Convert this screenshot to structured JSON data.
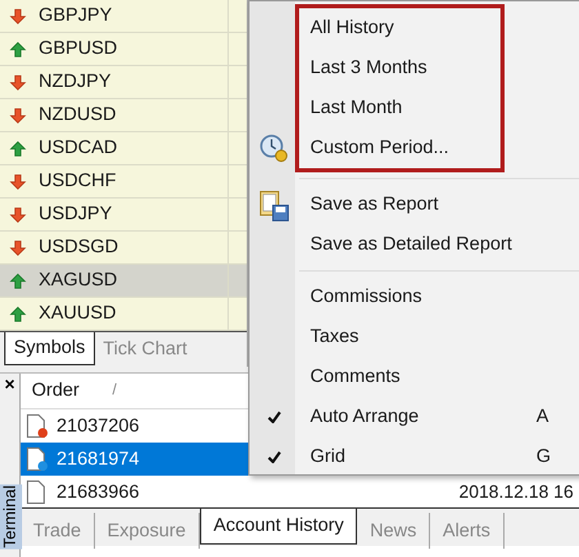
{
  "symbols": {
    "rows": [
      {
        "name": "GBPJPY",
        "kind": "down",
        "selected": false
      },
      {
        "name": "GBPUSD",
        "kind": "up",
        "selected": false
      },
      {
        "name": "NZDJPY",
        "kind": "down",
        "selected": false
      },
      {
        "name": "NZDUSD",
        "kind": "down",
        "selected": false
      },
      {
        "name": "USDCAD",
        "kind": "up",
        "selected": false
      },
      {
        "name": "USDCHF",
        "kind": "down",
        "selected": false
      },
      {
        "name": "USDJPY",
        "kind": "down",
        "selected": false
      },
      {
        "name": "USDSGD",
        "kind": "down",
        "selected": false
      },
      {
        "name": "XAGUSD",
        "kind": "up",
        "selected": true
      },
      {
        "name": "XAUUSD",
        "kind": "up",
        "selected": false
      }
    ],
    "tabs": [
      {
        "label": "Symbols",
        "selected": true
      },
      {
        "label": "Tick Chart",
        "selected": false
      }
    ]
  },
  "terminal": {
    "close": "×",
    "title": "Terminal",
    "columns": [
      "Order",
      "/"
    ],
    "rows": [
      {
        "order": "21037206",
        "kind": "red",
        "selected": false
      },
      {
        "order": "21681974",
        "kind": "blue",
        "selected": true
      },
      {
        "order": "21683966",
        "kind": "plain",
        "selected": false,
        "column_2": "2018.12.18 16"
      }
    ],
    "tabs": [
      {
        "label": "Trade",
        "selected": false
      },
      {
        "label": "Exposure",
        "selected": false
      },
      {
        "label": "Account History",
        "selected": true
      },
      {
        "label": "News",
        "selected": false
      },
      {
        "label": "Alerts",
        "selected": false
      }
    ]
  },
  "context_menu": {
    "items": [
      {
        "kind": "item",
        "label": "All History",
        "highlighted": true
      },
      {
        "kind": "item",
        "label": "Last 3 Months",
        "highlighted": true
      },
      {
        "kind": "item",
        "label": "Last Month",
        "highlighted": true
      },
      {
        "kind": "item",
        "label": "Custom Period...",
        "highlighted": true
      },
      {
        "kind": "separator"
      },
      {
        "kind": "item",
        "label": "Save as Report",
        "highlighted": false
      },
      {
        "kind": "item",
        "label": "Save as Detailed Report",
        "highlighted": false
      },
      {
        "kind": "separator"
      },
      {
        "kind": "item",
        "label": "Commissions",
        "highlighted": false,
        "checked": false
      },
      {
        "kind": "item",
        "label": "Taxes",
        "highlighted": false,
        "checked": false
      },
      {
        "kind": "item",
        "label": "Comments",
        "highlighted": false,
        "checked": false
      },
      {
        "kind": "item",
        "label": "Auto Arrange",
        "highlighted": false,
        "checked": true,
        "shortcut": "A"
      },
      {
        "kind": "item",
        "label": "Grid",
        "highlighted": false,
        "checked": true,
        "shortcut": "G"
      }
    ]
  }
}
